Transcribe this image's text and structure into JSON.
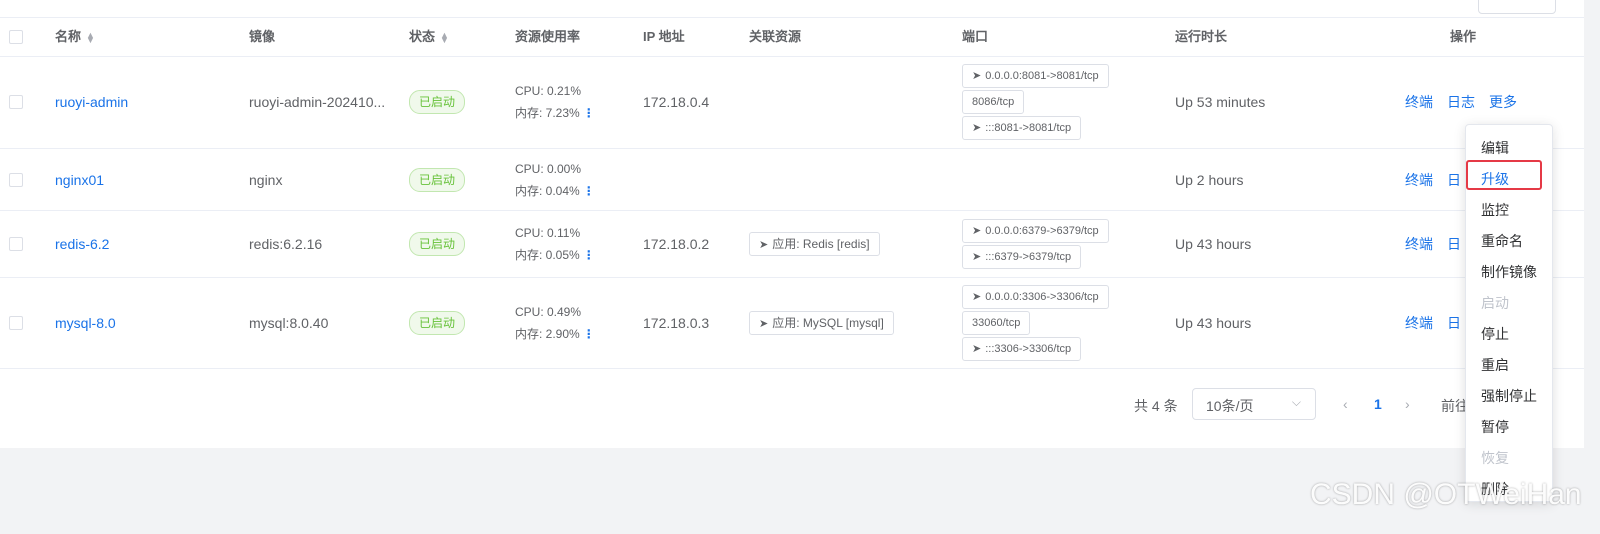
{
  "table": {
    "headers": {
      "name": "名称",
      "image": "镜像",
      "status": "状态",
      "resources": "资源使用率",
      "ip": "IP 地址",
      "linked": "关联资源",
      "ports": "端口",
      "uptime": "运行时长",
      "actions": "操作"
    },
    "rows": [
      {
        "name": "ruoyi-admin",
        "image": "ruoyi-admin-202410...",
        "status": "已启动",
        "cpu": "CPU: 0.21%",
        "mem": "内存: 7.23%",
        "ip": "172.18.0.4",
        "linked": "",
        "ports": [
          "0.0.0.0:8081->8081/tcp",
          "8086/tcp",
          ":::8081->8081/tcp"
        ],
        "uptime": "Up 53 minutes",
        "op_terminal": "终端",
        "op_log": "日志",
        "op_more": "更多"
      },
      {
        "name": "nginx01",
        "image": "nginx",
        "status": "已启动",
        "cpu": "CPU: 0.00%",
        "mem": "内存: 0.04%",
        "ip": "",
        "linked": "",
        "ports": [],
        "uptime": "Up 2 hours",
        "op_terminal": "终端",
        "op_log": "日"
      },
      {
        "name": "redis-6.2",
        "image": "redis:6.2.16",
        "status": "已启动",
        "cpu": "CPU: 0.11%",
        "mem": "内存: 0.05%",
        "ip": "172.18.0.2",
        "linked": "应用: Redis [redis]",
        "ports": [
          "0.0.0.0:6379->6379/tcp",
          ":::6379->6379/tcp"
        ],
        "uptime": "Up 43 hours",
        "op_terminal": "终端",
        "op_log": "日"
      },
      {
        "name": "mysql-8.0",
        "image": "mysql:8.0.40",
        "status": "已启动",
        "cpu": "CPU: 0.49%",
        "mem": "内存: 2.90%",
        "ip": "172.18.0.3",
        "linked": "应用: MySQL [mysql]",
        "ports": [
          "0.0.0.0:3306->3306/tcp",
          "33060/tcp",
          ":::3306->3306/tcp"
        ],
        "uptime": "Up 43 hours",
        "op_terminal": "终端",
        "op_log": "日"
      }
    ]
  },
  "pagination": {
    "total": "共 4 条",
    "page_size": "10条/页",
    "current_page": "1",
    "goto": "前往"
  },
  "more_menu": {
    "items": [
      "编辑",
      "升级",
      "监控",
      "重命名",
      "制作镜像",
      "启动",
      "停止",
      "重启",
      "强制停止",
      "暂停",
      "恢复",
      "删除"
    ],
    "disabled": [
      "启动",
      "恢复"
    ],
    "highlighted": "升级"
  },
  "watermark": "CSDN @OTWeiHan",
  "colors": {
    "link": "#1a73e8",
    "status_green": "#67c23a",
    "highlight_border": "#e53946"
  }
}
